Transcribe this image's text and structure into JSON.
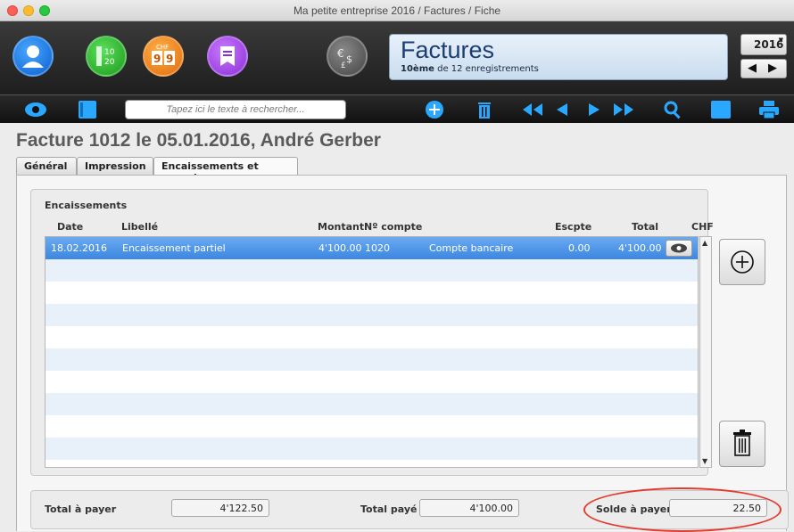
{
  "window": {
    "title": "Ma petite entreprise 2016 / Factures / Fiche"
  },
  "header": {
    "icons": [
      "user-icon",
      "numbers-icon",
      "currency-chf-icon",
      "bookmark-icon",
      "currency-exchange-icon"
    ],
    "chf_label": "CHF",
    "module_title": "Factures",
    "record_index": "10ème",
    "record_suffix": "de 12 enregistrements",
    "year": "2016",
    "num_lines": [
      "10",
      "20"
    ]
  },
  "toolbar": {
    "search_placeholder": "Tapez ici le texte à rechercher..."
  },
  "document": {
    "title": "Facture 1012 le 05.01.2016, André Gerber",
    "tabs": [
      {
        "label": "Général",
        "active": false
      },
      {
        "label": "Impression",
        "active": false
      },
      {
        "label": "Encaissements et rappels",
        "active": true
      }
    ]
  },
  "encaissements": {
    "label": "Encaissements",
    "columns": {
      "date": "Date",
      "libelle": "Libellé",
      "montant": "Montant",
      "compte": "Nº compte",
      "escpte": "Escpte",
      "total": "Total",
      "chf": "CHF"
    },
    "rows": [
      {
        "date": "18.02.2016",
        "libelle": "Encaissement partiel",
        "montant": "4'100.00",
        "compte_no": "1020",
        "compte_nom": "Compte bancaire",
        "escpte": "0.00",
        "total": "4'100.00"
      }
    ]
  },
  "totals": {
    "a_payer_label": "Total à payer",
    "a_payer": "4'122.50",
    "paye_label": "Total payé",
    "paye": "4'100.00",
    "solde_label": "Solde à payer",
    "solde": "22.50"
  },
  "colors": {
    "selection": "#3c87e0",
    "accent": "#2aa8ff",
    "highlight": "#e53a2e",
    "title_blue": "#1b3e73"
  }
}
